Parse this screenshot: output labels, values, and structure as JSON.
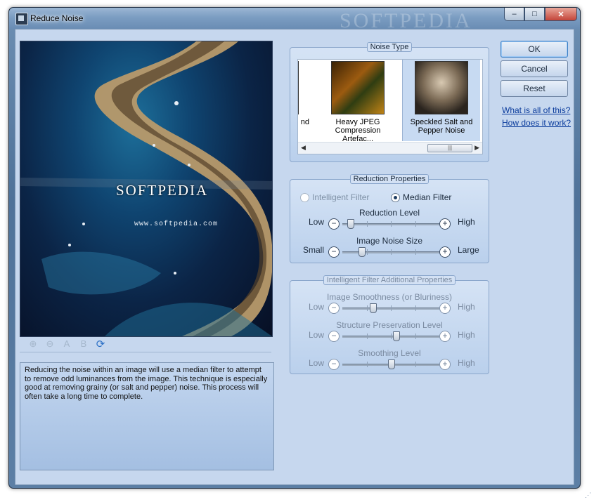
{
  "window": {
    "title": "Reduce Noise",
    "watermark": "SOFTPEDIA",
    "minimize": "–",
    "maximize": "□",
    "close": "✕"
  },
  "preview": {
    "watermark_text": "SOFTPEDIA",
    "watermark_url": "www.softpedia.com",
    "toolbar": [
      {
        "name": "zoom-in-icon",
        "glyph": "⊕"
      },
      {
        "name": "zoom-out-icon",
        "glyph": "⊖"
      },
      {
        "name": "view-a-icon",
        "glyph": "A"
      },
      {
        "name": "view-b-icon",
        "glyph": "B"
      },
      {
        "name": "refresh-icon",
        "glyph": "⟳"
      }
    ]
  },
  "description": "Reducing the noise within an image will use a median filter to attempt to remove odd luminances from the image. This technique is especially good at removing grainy (or salt and pepper) noise. This process will often take a long time to complete.",
  "noise_type": {
    "title": "Noise Type",
    "items": [
      {
        "label": "nd",
        "selected": false
      },
      {
        "label": "Heavy JPEG Compression Artefac...",
        "selected": false
      },
      {
        "label": "Speckled Salt and Pepper Noise",
        "selected": true
      }
    ],
    "scroll_thumb": "|||"
  },
  "reduction": {
    "title": "Reduction Properties",
    "filter_options": [
      {
        "label": "Intelligent Filter",
        "checked": false
      },
      {
        "label": "Median Filter",
        "checked": true
      }
    ],
    "sliders": [
      {
        "label": "Reduction Level",
        "low": "Low",
        "high": "High",
        "value": 0.05
      },
      {
        "label": "Image Noise Size",
        "low": "Small",
        "high": "Large",
        "value": 0.18
      }
    ]
  },
  "intelligent": {
    "title": "Intelligent Filter Additional Properties",
    "sliders": [
      {
        "label": "Image Smoothness (or Bluriness)",
        "low": "Low",
        "high": "High",
        "value": 0.3
      },
      {
        "label": "Structure Preservation Level",
        "low": "Low",
        "high": "High",
        "value": 0.55
      },
      {
        "label": "Smoothing Level",
        "low": "Low",
        "high": "High",
        "value": 0.5
      }
    ]
  },
  "buttons": {
    "ok": "OK",
    "cancel": "Cancel",
    "reset": "Reset"
  },
  "links": {
    "what": "What is all of this?",
    "how": "How does it work?"
  },
  "symbols": {
    "minus": "−",
    "plus": "+"
  }
}
